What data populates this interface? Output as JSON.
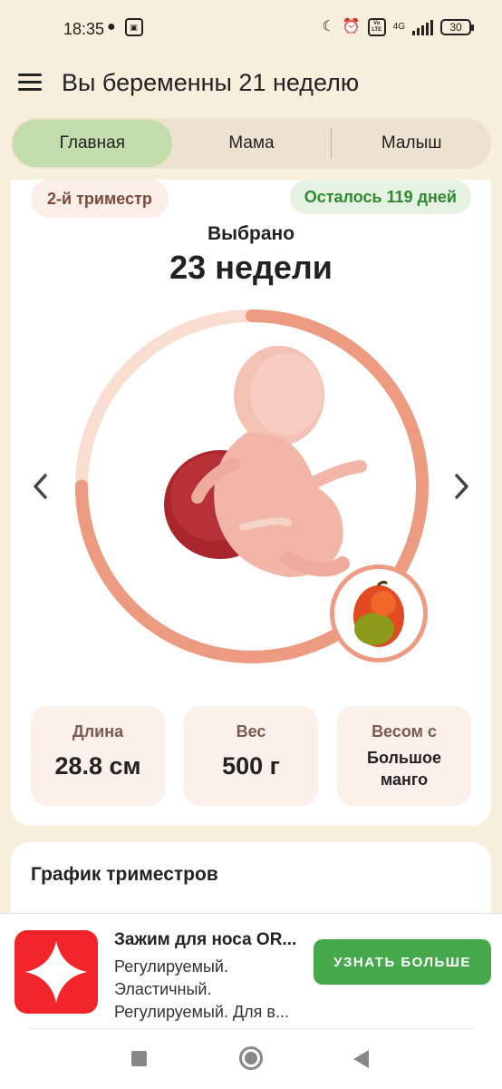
{
  "status_bar": {
    "time": "18:35",
    "lte_label": "Vo LTE",
    "network": "4G",
    "battery": "30"
  },
  "app_bar": {
    "title": "Вы беременны 21 неделю"
  },
  "tabs": [
    {
      "label": "Главная",
      "active": true
    },
    {
      "label": "Мама",
      "active": false
    },
    {
      "label": "Малыш",
      "active": false
    }
  ],
  "week_card": {
    "trimester": "2-й триместр",
    "remaining": "Осталось 119 дней",
    "selected_label": "Выбрано",
    "selected_week": "23 недели",
    "progress_fraction": 0.75,
    "fruit_icon": "mango-icon",
    "stats": [
      {
        "label": "Длина",
        "value": "28.8 см"
      },
      {
        "label": "Вес",
        "value": "500 г"
      },
      {
        "label": "Весом с",
        "value": "Большое манго"
      }
    ]
  },
  "trimester_chart": {
    "title": "График триместров"
  },
  "ad": {
    "title": "Зажим для носа OR...",
    "description": "Регулируемый. Эластичный. Регулируемый. Для в...",
    "button_label": "УЗНАТЬ БОЛЬШЕ"
  },
  "colors": {
    "background": "#f7eedc",
    "active_tab": "#c2ddab",
    "ring_progress": "#ec9a80",
    "ring_track": "#f9ddd1",
    "remaining_text": "#2d8a2e",
    "ad_button": "#45a84b",
    "ad_logo": "#f2252b"
  }
}
